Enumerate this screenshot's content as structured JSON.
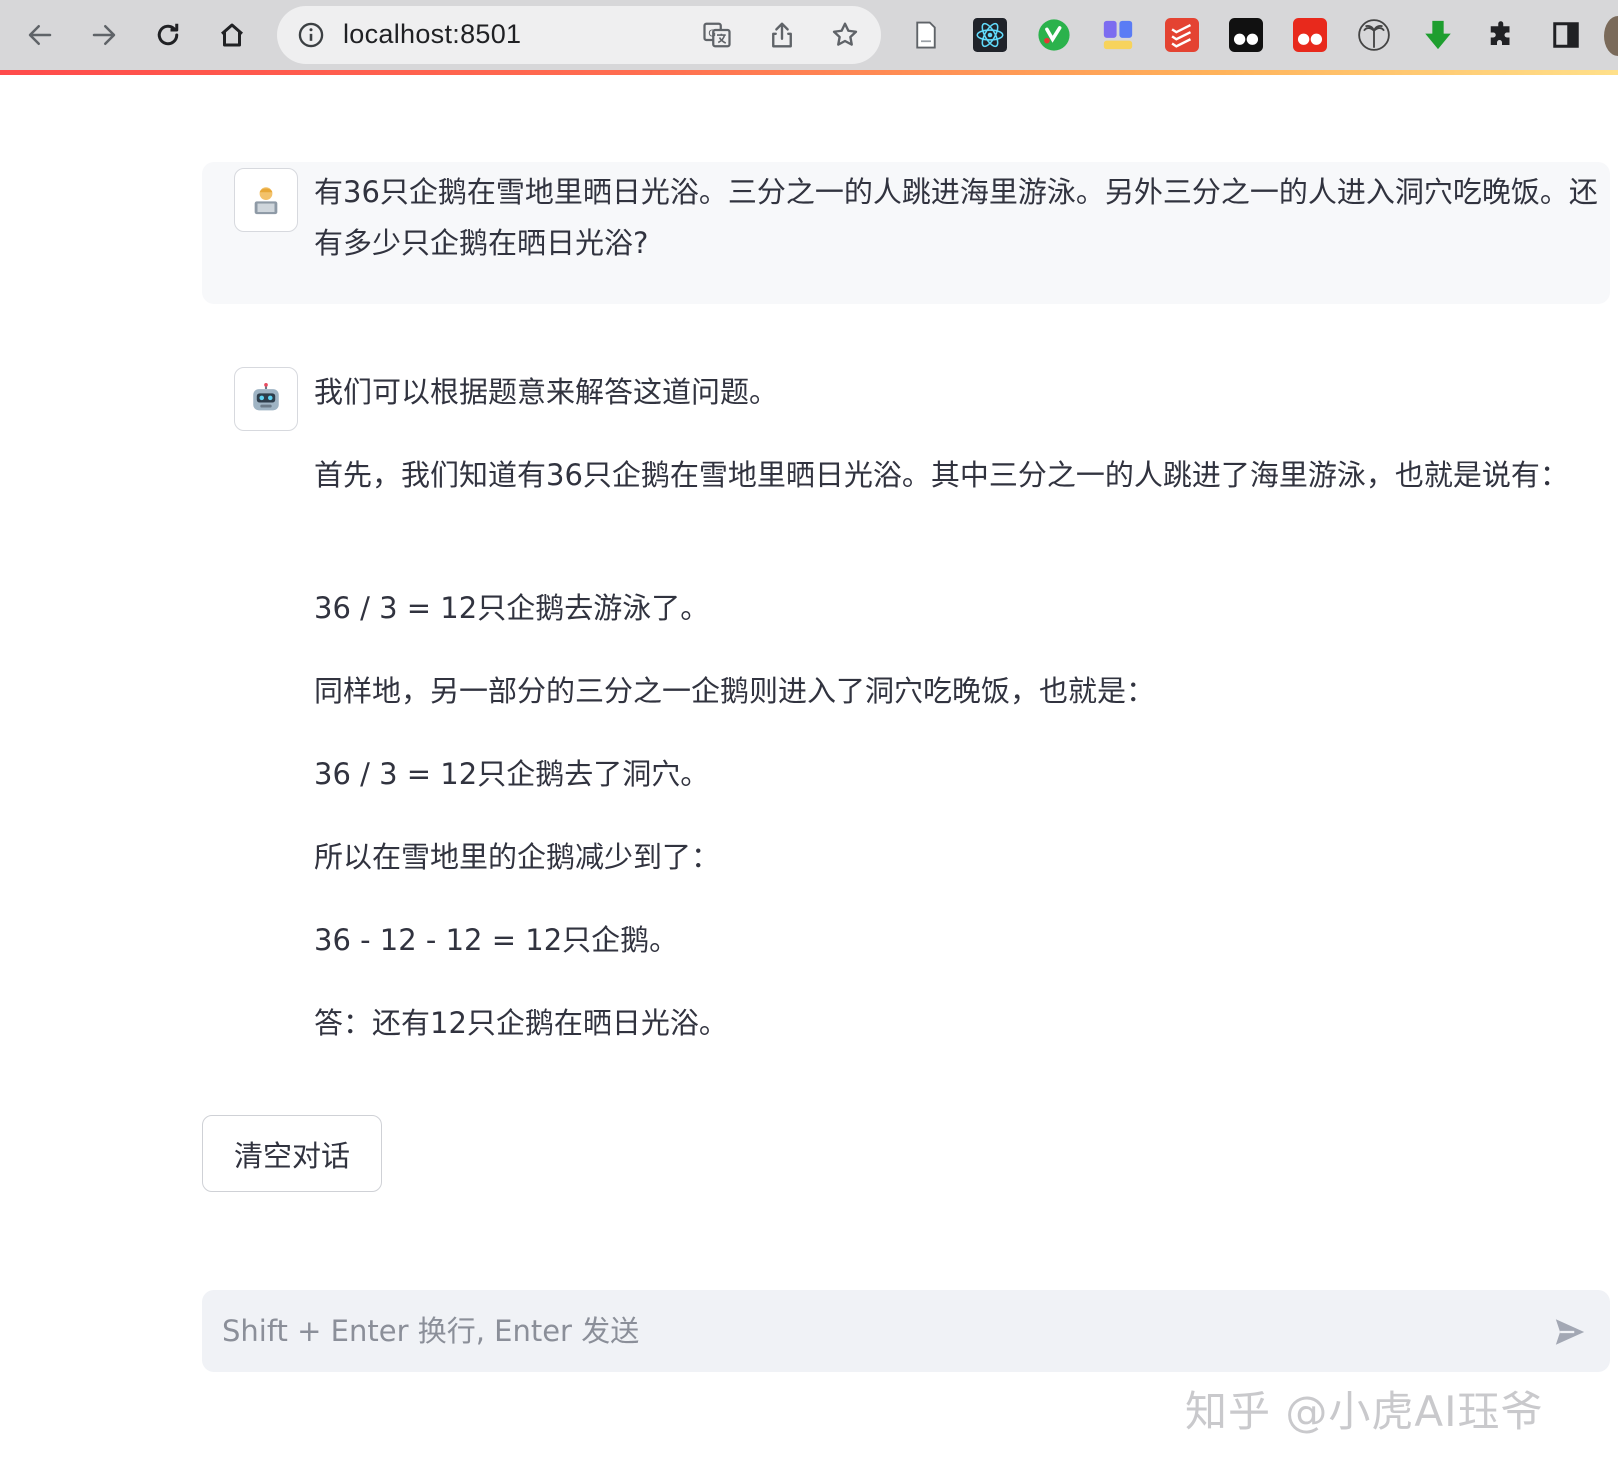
{
  "browser": {
    "url": "localhost:8501",
    "accent_gradient": [
      "#ff4b4b",
      "#ffb25a",
      "#ffe08a"
    ],
    "nav_icons": [
      "back-arrow-icon",
      "forward-arrow-icon",
      "reload-icon",
      "home-icon"
    ],
    "omnibox_icons": [
      "site-info-icon",
      "translate-icon",
      "share-icon",
      "bookmark-star-icon"
    ],
    "extension_icons": [
      "document-icon",
      "react-devtools-icon",
      "green-check-extension-icon",
      "blocks-extension-icon",
      "todoist-icon",
      "tampermonkey-dark-icon",
      "tampermonkey-red-icon",
      "palm-tree-icon",
      "download-arrow-icon",
      "puzzle-extensions-icon",
      "sidepanel-icon"
    ]
  },
  "chat": {
    "user_message": "有36只企鹅在雪地里晒日光浴。三分之一的人跳进海里游泳。另外三分之一的人进入洞穴吃晚饭。还有多少只企鹅在晒日光浴?",
    "user_avatar_icon": "person-laptop-icon",
    "bot_avatar_icon": "robot-icon",
    "bot_message": [
      "我们可以根据题意来解答这道问题。",
      "首先，我们知道有36只企鹅在雪地里晒日光浴。其中三分之一的人跳进了海里游泳，也就是说有：",
      "36 / 3 = 12只企鹅去游泳了。",
      "同样地，另一部分的三分之一企鹅则进入了洞穴吃晚饭，也就是：",
      "36 / 3 = 12只企鹅去了洞穴。",
      "所以在雪地里的企鹅减少到了：",
      "36 - 12 - 12 = 12只企鹅。",
      "答：还有12只企鹅在晒日光浴。"
    ],
    "clear_button_label": "清空对话",
    "input_placeholder": "Shift + Enter 换行, Enter 发送",
    "input_value": "",
    "send_icon": "send-icon"
  },
  "watermark": "知乎 @小虎AI珏爷"
}
